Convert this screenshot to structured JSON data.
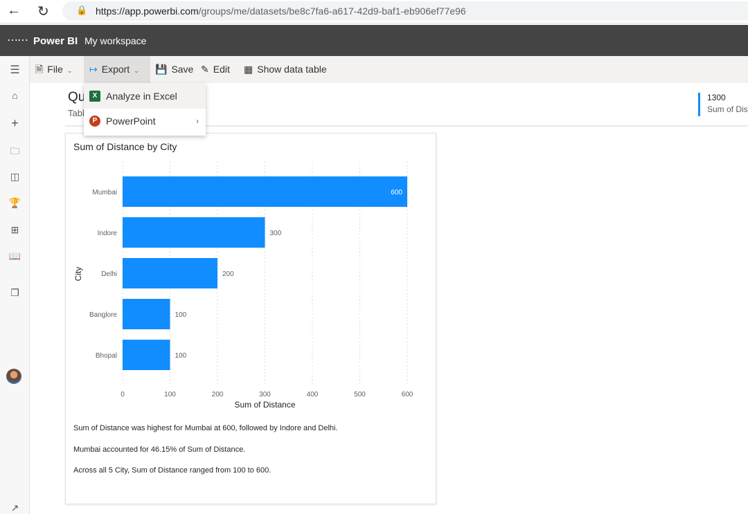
{
  "browser": {
    "url_host": "https://app.powerbi.com",
    "url_path": "/groups/me/datasets/be8c7fa6-a617-42d9-baf1-eb906ef77e96"
  },
  "header": {
    "brand": "Power BI",
    "workspace": "My workspace"
  },
  "toolbar": {
    "file": "File",
    "export": "Export",
    "save": "Save",
    "edit": "Edit",
    "show_data_table": "Show data table"
  },
  "export_menu": {
    "items": [
      {
        "label": "Analyze in Excel",
        "icon": "excel-icon"
      },
      {
        "label": "PowerPoint",
        "icon": "powerpoint-icon"
      }
    ]
  },
  "page": {
    "title": "Qu",
    "subtitle": "Tabl"
  },
  "kpi": {
    "value": "1300",
    "label": "Sum of Dis"
  },
  "colors": {
    "bar": "#118dff",
    "accent": "#118dff",
    "topbar": "#444444"
  },
  "chart_data": {
    "type": "bar",
    "orientation": "horizontal",
    "title": "Sum of Distance by City",
    "xlabel": "Sum of Distance",
    "ylabel": "City",
    "categories": [
      "Mumbai",
      "Indore",
      "Delhi",
      "Banglore",
      "Bhopal"
    ],
    "values": [
      600,
      300,
      200,
      100,
      100
    ],
    "xlim": [
      0,
      600
    ],
    "xticks": [
      0,
      100,
      200,
      300,
      400,
      500,
      600
    ],
    "grid": true
  },
  "narrative": [
    "Sum of Distance was highest for Mumbai at 600, followed by Indore and Delhi.",
    "Mumbai accounted for 46.15% of Sum of Distance.",
    "Across all 5 City, Sum of Distance ranged from 100 to 600."
  ]
}
